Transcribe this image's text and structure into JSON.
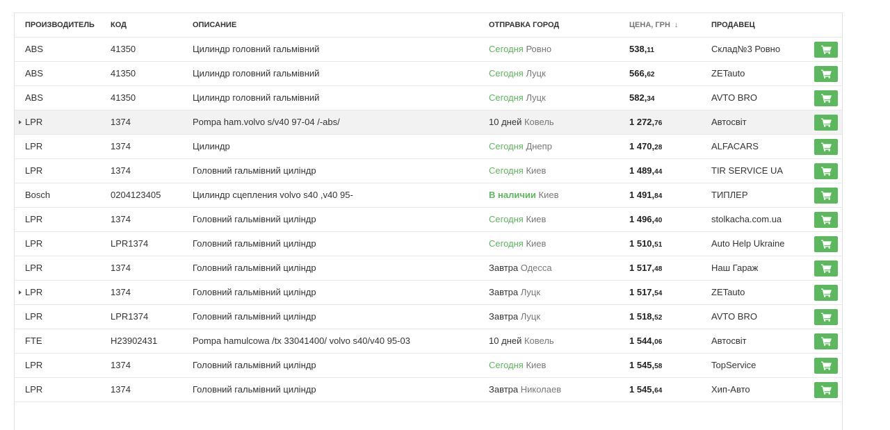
{
  "header": {
    "maker": "ПРОИЗВОДИТЕЛЬ",
    "code": "КОД",
    "description": "ОПИСАНИЕ",
    "shipping": "ОТПРАВКА  ГОРОД",
    "price": "ЦЕНА, ГРН",
    "price_sort_icon": "↓",
    "seller": "ПРОДАВЕЦ"
  },
  "colors": {
    "green": "#5cb85c",
    "highlight_row": "#f2f2f2"
  },
  "icons": {
    "cart": "shopping-cart-icon",
    "expand": "caret-right-icon",
    "sort": "arrow-down-icon"
  },
  "rows": [
    {
      "maker": "ABS",
      "code": "41350",
      "description": "Цилиндр головний гальмівний",
      "when": "Сегодня",
      "when_style": "green",
      "city": "Ровно",
      "price_main": "538,",
      "price_kop": "11",
      "seller": "Склад№3 Ровно",
      "caret": false,
      "highlight": false
    },
    {
      "maker": "ABS",
      "code": "41350",
      "description": "Цилиндр головний гальмівний",
      "when": "Сегодня",
      "when_style": "green",
      "city": "Луцк",
      "price_main": "566,",
      "price_kop": "62",
      "seller": "ZETauto",
      "caret": false,
      "highlight": false
    },
    {
      "maker": "ABS",
      "code": "41350",
      "description": "Цилиндр головний гальмівний",
      "when": "Сегодня",
      "when_style": "green",
      "city": "Луцк",
      "price_main": "582,",
      "price_kop": "34",
      "seller": "AVTO BRO",
      "caret": false,
      "highlight": false
    },
    {
      "maker": "LPR",
      "code": "1374",
      "description": "Pompa ham.volvo s/v40 97-04 /-abs/",
      "when": "10 дней",
      "when_style": "plain",
      "city": "Ковель",
      "price_main": "1 272,",
      "price_kop": "76",
      "seller": "Автосвіт",
      "caret": true,
      "highlight": true
    },
    {
      "maker": "LPR",
      "code": "1374",
      "description": "Цилиндр",
      "when": "Сегодня",
      "when_style": "green",
      "city": "Днепр",
      "price_main": "1 470,",
      "price_kop": "28",
      "seller": "ALFACARS",
      "caret": false,
      "highlight": false
    },
    {
      "maker": "LPR",
      "code": "1374",
      "description": "Головний гальмівний циліндр",
      "when": "Сегодня",
      "when_style": "green",
      "city": "Киев",
      "price_main": "1 489,",
      "price_kop": "44",
      "seller": "TIR SERVICE UA",
      "caret": false,
      "highlight": false
    },
    {
      "maker": "Bosch",
      "code": "0204123405",
      "description": "Цилиндр сцепления volvo s40 ,v40 95-",
      "when": "В наличии",
      "when_style": "green-bold",
      "city": "Киев",
      "price_main": "1 491,",
      "price_kop": "84",
      "seller": "ТИПЛЕР",
      "caret": false,
      "highlight": false
    },
    {
      "maker": "LPR",
      "code": "1374",
      "description": "Головний гальмівний циліндр",
      "when": "Сегодня",
      "when_style": "green",
      "city": "Киев",
      "price_main": "1 496,",
      "price_kop": "40",
      "seller": "stolkacha.com.ua",
      "caret": false,
      "highlight": false
    },
    {
      "maker": "LPR",
      "code": "LPR1374",
      "description": "Головний гальмівний циліндр",
      "when": "Сегодня",
      "when_style": "green",
      "city": "Киев",
      "price_main": "1 510,",
      "price_kop": "51",
      "seller": "Auto Help Ukraine",
      "caret": false,
      "highlight": false
    },
    {
      "maker": "LPR",
      "code": "1374",
      "description": "Головний гальмівний циліндр",
      "when": "Завтра",
      "when_style": "plain",
      "city": "Одесса",
      "price_main": "1 517,",
      "price_kop": "48",
      "seller": "Наш Гараж",
      "caret": false,
      "highlight": false
    },
    {
      "maker": "LPR",
      "code": "1374",
      "description": "Головний гальмівний циліндр",
      "when": "Завтра",
      "when_style": "plain",
      "city": "Луцк",
      "price_main": "1 517,",
      "price_kop": "54",
      "seller": "ZETauto",
      "caret": true,
      "highlight": false
    },
    {
      "maker": "LPR",
      "code": "LPR1374",
      "description": "Головний гальмівний циліндр",
      "when": "Завтра",
      "when_style": "plain",
      "city": "Луцк",
      "price_main": "1 518,",
      "price_kop": "52",
      "seller": "AVTO BRO",
      "caret": false,
      "highlight": false
    },
    {
      "maker": "FTE",
      "code": "H23902431",
      "description": "Pompa hamulcowa /tx 33041400/ volvo s40/v40 95-03",
      "when": "10 дней",
      "when_style": "plain",
      "city": "Ковель",
      "price_main": "1 544,",
      "price_kop": "06",
      "seller": "Автосвіт",
      "caret": false,
      "highlight": false
    },
    {
      "maker": "LPR",
      "code": "1374",
      "description": "Головний гальмівний циліндр",
      "when": "Сегодня",
      "when_style": "green",
      "city": "Киев",
      "price_main": "1 545,",
      "price_kop": "58",
      "seller": "TopService",
      "caret": false,
      "highlight": false
    },
    {
      "maker": "LPR",
      "code": "1374",
      "description": "Головний гальмівний циліндр",
      "when": "Завтра",
      "when_style": "plain",
      "city": "Николаев",
      "price_main": "1 545,",
      "price_kop": "64",
      "seller": "Хип-Авто",
      "caret": false,
      "highlight": false
    }
  ]
}
